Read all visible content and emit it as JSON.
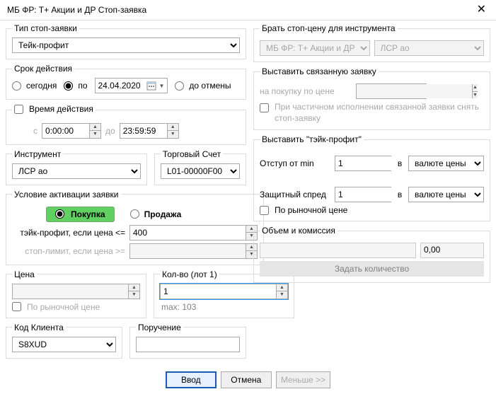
{
  "window": {
    "title": "МБ ФР: T+ Акции и ДР Стоп-заявка"
  },
  "stop_type": {
    "legend": "Тип стоп-заявки",
    "value": "Тейк-профит"
  },
  "expiry": {
    "legend": "Срок действия",
    "today": "сегодня",
    "until": "по",
    "date": "24.04.2020",
    "gtc": "до отмены"
  },
  "active_time": {
    "legend": "Время действия",
    "from": "с",
    "from_val": "0:00:00",
    "to": "до",
    "to_val": "23:59:59"
  },
  "instrument": {
    "legend": "Инструмент",
    "value": "ЛСР ао"
  },
  "account": {
    "legend": "Торговый Счет",
    "value": "L01-00000F00"
  },
  "activation": {
    "legend": "Условие активации заявки",
    "buy": "Покупка",
    "sell": "Продажа",
    "tp_label": "тэйк-профит, если цена <=",
    "tp_val": "400",
    "sl_label": "стоп-лимит, если цена >=",
    "sl_val": ""
  },
  "price": {
    "legend": "Цена",
    "market": "По рыночной цене",
    "val": ""
  },
  "qty": {
    "legend": "Кол-во (лот 1)",
    "val": "1",
    "max": "max: 103"
  },
  "client": {
    "legend": "Код Клиента",
    "value": "S8XUD"
  },
  "comment": {
    "legend": "Поручение",
    "value": ""
  },
  "buttons": {
    "submit": "Ввод",
    "cancel": "Отмена",
    "less": "Меньше >>"
  },
  "right": {
    "stop_source": {
      "legend": "Брать стоп-цену для инструмента",
      "market": "МБ ФР: T+ Акции и ДР",
      "inst": "ЛСР ао"
    },
    "linked": {
      "legend": "Выставить связанную заявку",
      "buy_at": "на покупку по цене",
      "partial": "При частичном исполнении связанной заявки снять стоп-заявку",
      "val": ""
    },
    "tp": {
      "legend": "Выставить \"тэйк-профит\"",
      "offset": "Отступ от min",
      "offset_val": "1",
      "spread": "Защитный спред",
      "spread_val": "1",
      "in": "в",
      "unit": "валюте цены",
      "market": "По рыночной цене"
    },
    "volume": {
      "legend": "Объем и комиссия",
      "vol": "",
      "fee": "0,00",
      "set_qty": "Задать количество"
    }
  }
}
